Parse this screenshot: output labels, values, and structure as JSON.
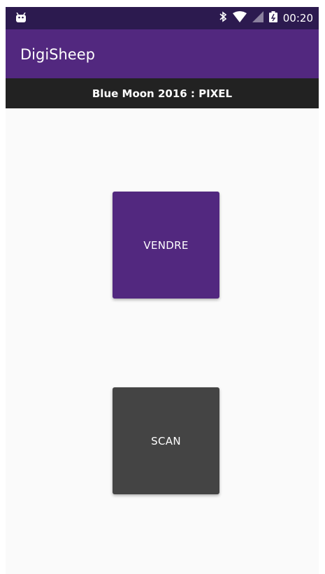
{
  "status_bar": {
    "time": "00:20",
    "icons": [
      "android-icon",
      "bluetooth-icon",
      "wifi-icon",
      "signal-icon",
      "battery-icon"
    ]
  },
  "app_bar": {
    "title": "DigiSheep"
  },
  "sub_header": {
    "text": "Blue Moon 2016 : PIXEL"
  },
  "buttons": {
    "vendre_label": "VENDRE",
    "scan_label": "SCAN"
  },
  "colors": {
    "status_bar": "#2c1a4f",
    "primary": "#52287f",
    "sub_header": "#222222",
    "scan_button": "#444444",
    "background": "#fafafa"
  }
}
